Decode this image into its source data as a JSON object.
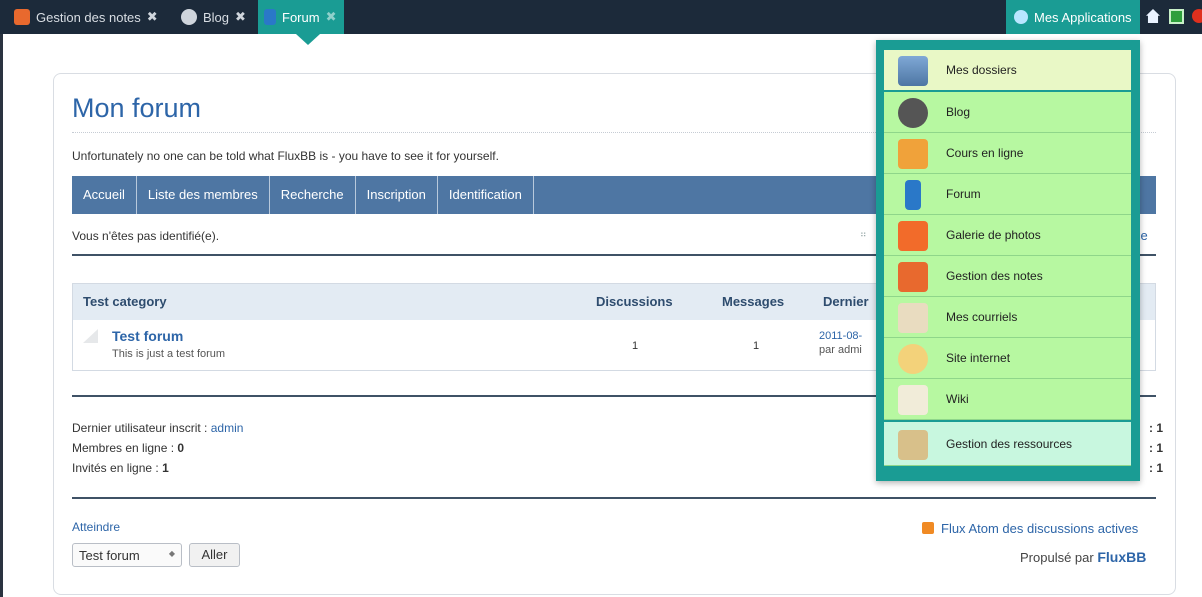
{
  "browser_tabs": [
    {
      "label": "Gestion des notes",
      "color": "#e8692e"
    },
    {
      "label": "Blog",
      "color": "#cfd5dc"
    },
    {
      "label": "Forum",
      "color": "#2a78c8",
      "active": true
    }
  ],
  "tab_close_glyph": "✖",
  "apps_button": {
    "label": "Mes Applications"
  },
  "page": {
    "title": "Mon forum",
    "description": "Unfortunately no one can be told what FluxBB is - you have to see it for yourself."
  },
  "nav": {
    "items": [
      "Accueil",
      "Liste des membres",
      "Recherche",
      "Inscription",
      "Identification"
    ]
  },
  "status": {
    "not_logged": "Vous n'êtes pas identifié(e).",
    "dots": "⠶",
    "right_fragment": "se"
  },
  "table": {
    "headers": {
      "category": "Test category",
      "topics": "Discussions",
      "posts": "Messages",
      "last_post": "Dernier"
    },
    "rows": [
      {
        "title": "Test forum",
        "description": "This is just a test forum",
        "topics": "1",
        "posts": "1",
        "last_date": "2011-08-",
        "last_by": "par admi"
      }
    ]
  },
  "stats": {
    "newest_user_label": "Dernier utilisateur inscrit : ",
    "newest_user": "admin",
    "members_online_label": "Membres en ligne : ",
    "members_online": "0",
    "guests_online_label": "Invités en ligne : ",
    "guests_online": "1",
    "right_values": [
      ": 1",
      ": 1",
      ": 1"
    ]
  },
  "footer": {
    "goto_label": "Atteindre",
    "goto_selected": "Test forum",
    "go_button": "Aller",
    "rss_link": "Flux Atom des discussions actives",
    "powered_prefix": "Propulsé par ",
    "powered_brand": "FluxBB"
  },
  "apps_menu": [
    {
      "label": "Mes dossiers",
      "icon": "folder-icon"
    },
    {
      "label": "Blog",
      "icon": "wordpress-icon"
    },
    {
      "label": "Cours en ligne",
      "icon": "moodle-icon"
    },
    {
      "label": "Forum",
      "icon": "forum-icon"
    },
    {
      "label": "Galerie de photos",
      "icon": "camera-icon"
    },
    {
      "label": "Gestion des notes",
      "icon": "grades-icon"
    },
    {
      "label": "Mes courriels",
      "icon": "mail-icon"
    },
    {
      "label": "Site internet",
      "icon": "website-icon"
    },
    {
      "label": "Wiki",
      "icon": "wiki-icon"
    },
    {
      "label": "Gestion des ressources",
      "icon": "resources-icon"
    }
  ],
  "colors": {
    "topbar": "#1c2a3a",
    "accent_teal": "#1a9c94",
    "nav_blue": "#4e76a3",
    "link_blue": "#2d65a8",
    "menu_green": "#b7f8a1"
  }
}
